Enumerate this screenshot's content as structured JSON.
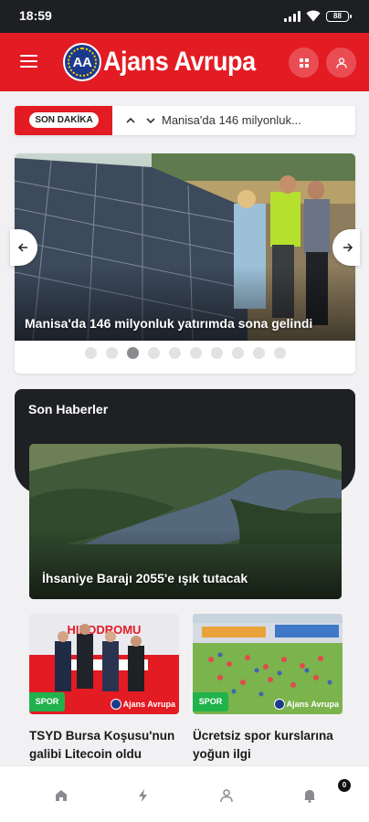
{
  "status": {
    "time": "18:59",
    "battery": "88"
  },
  "header": {
    "logo_badge": "AA",
    "logo_text": "Ajans Avrupa",
    "brand_color": "#e31b23"
  },
  "ticker": {
    "label": "SON DAKİKA",
    "text": "Manisa'da 146 milyonluk..."
  },
  "slider": {
    "caption": "Manisa'da 146 milyonluk yatırımda sona gelindi",
    "slide_count": 10,
    "active_index": 2
  },
  "latest_news": {
    "title": "Son Haberler",
    "featured_caption": "İhsaniye Barajı 2055'e ışık tutacak",
    "cards": [
      {
        "category": "SPOR",
        "title": "TSYD Bursa Koşusu'nun galibi Litecoin oldu",
        "watermark": "Ajans Avrupa",
        "image_text": "HIPODROMU"
      },
      {
        "category": "SPOR",
        "title": "Ücretsiz spor kurslarına yoğun ilgi",
        "watermark": "Ajans Avrupa"
      }
    ]
  },
  "bottom_nav": {
    "items": [
      "home-icon",
      "flash-icon",
      "profile-icon",
      "bell-icon"
    ],
    "notification_count": "0"
  }
}
